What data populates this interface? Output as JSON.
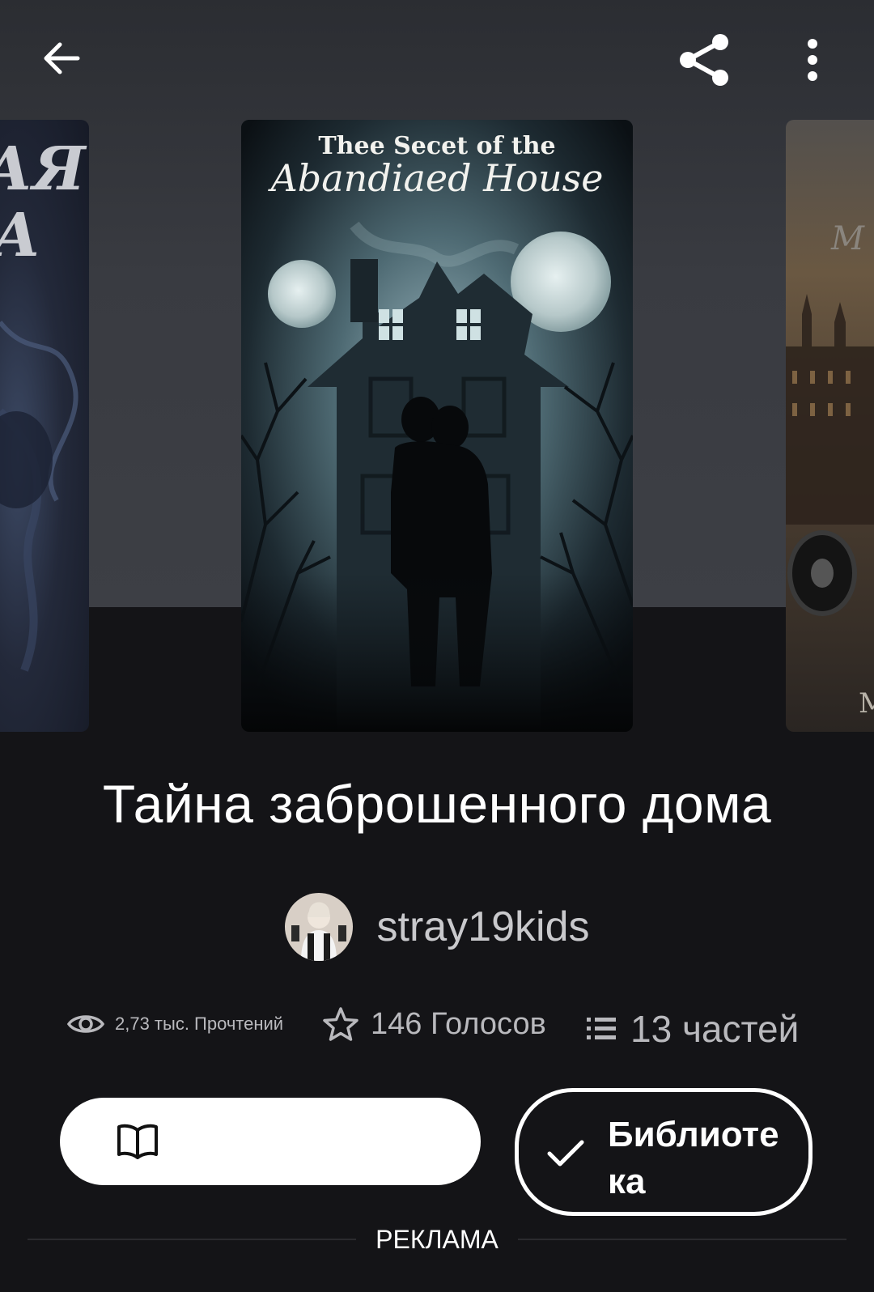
{
  "hero": {
    "main_cover_title_line1": "Thee Secet of the",
    "main_cover_title_line2": "Abandiaed House",
    "left_cover_text_line1": "АЯ",
    "left_cover_text_line2": "А",
    "right_cover_text_top": "M",
    "right_cover_text_bottom": "M"
  },
  "icons": {
    "back": "arrow-left-icon",
    "share": "share-icon",
    "more": "more-vertical-icon",
    "reads": "eye-icon",
    "votes": "star-icon",
    "parts": "list-icon",
    "read": "book-open-icon",
    "library": "check-icon"
  },
  "story": {
    "title": "Тайна заброшенного дома",
    "author": "stray19kids"
  },
  "stats": {
    "reads": "2,73 тыс. Прочтений",
    "votes": "146 Голосов",
    "parts": "13 частей"
  },
  "actions": {
    "read_label": "",
    "library_label": "Библиотека"
  },
  "ad": {
    "label": "РЕКЛАМА"
  },
  "colors": {
    "background": "#141417",
    "hero_background": "#3a3c42",
    "accent": "#ffffff",
    "secondary_text": "#b9b9bd"
  }
}
